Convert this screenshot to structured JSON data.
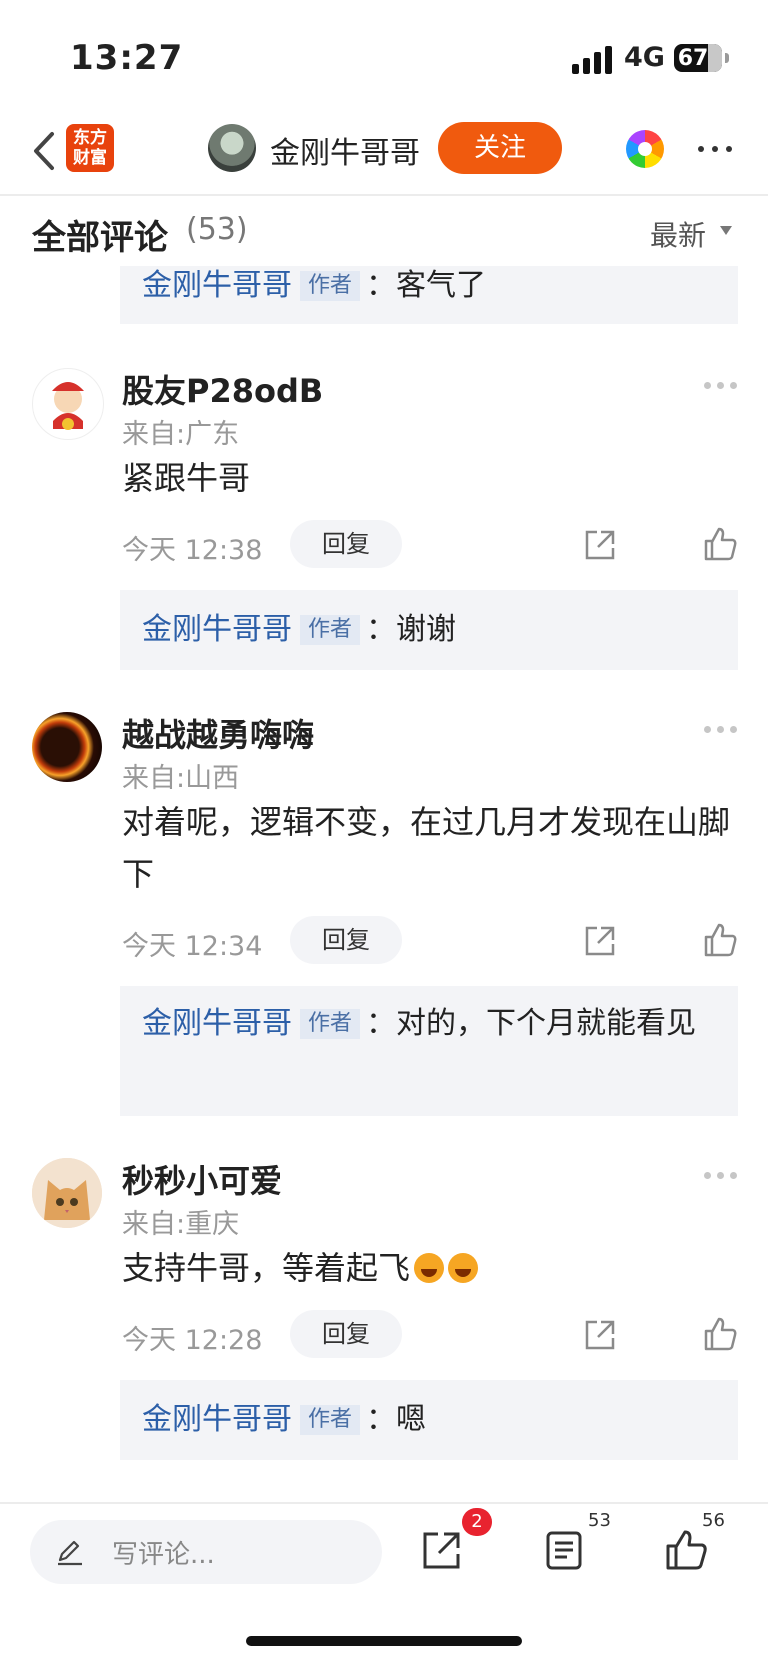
{
  "status": {
    "time": "13:27",
    "network": "4G",
    "battery": "67"
  },
  "nav": {
    "logo_line1": "东方",
    "logo_line2": "财富",
    "author_name": "金刚牛哥哥",
    "follow_label": "关注"
  },
  "header": {
    "title": "全部评论",
    "count": "(53)",
    "sort": "最新"
  },
  "author_tag": "作者",
  "top_reply": {
    "name": "金刚牛哥哥",
    "sep": "：",
    "text": "客气了"
  },
  "comments": [
    {
      "user": "股友P28odB",
      "location": "来自:广东",
      "text": "紧跟牛哥",
      "time": "今天 12:38",
      "reply_label": "回复",
      "reply": {
        "name": "金刚牛哥哥",
        "sep": "：",
        "text": "谢谢"
      }
    },
    {
      "user": "越战越勇嗨嗨",
      "location": "来自:山西",
      "text": "对着呢，逻辑不变，在过几月才发现在山脚下",
      "time": "今天 12:34",
      "reply_label": "回复",
      "reply": {
        "name": "金刚牛哥哥",
        "sep": "：",
        "text": "对的，下个月就能看见"
      }
    },
    {
      "user": "秒秒小可爱",
      "location": "来自:重庆",
      "text": "支持牛哥，等着起飞",
      "time": "今天 12:28",
      "reply_label": "回复",
      "reply": {
        "name": "金刚牛哥哥",
        "sep": "：",
        "text": "嗯"
      }
    }
  ],
  "bottom": {
    "placeholder": "写评论...",
    "share_badge": "2",
    "comment_count": "53",
    "like_count": "56"
  }
}
